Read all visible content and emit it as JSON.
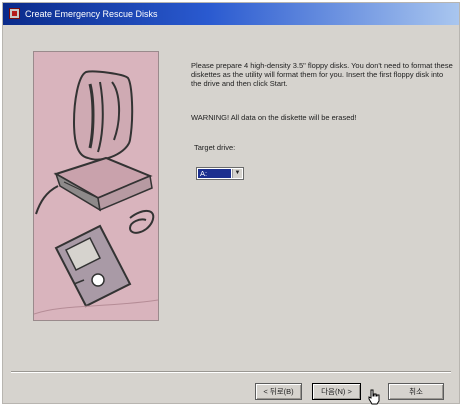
{
  "window": {
    "title": "Create Emergency Rescue Disks"
  },
  "content": {
    "instructions": "Please prepare 4 high-density 3.5\" floppy disks. You don't need to format these diskettes as the utility will format them for you. Insert the first floppy disk into the drive and then click Start.",
    "warning": "WARNING! All data on the diskette will be erased!",
    "target_drive_label": "Target drive:",
    "target_drive_value": "A:"
  },
  "buttons": {
    "back": "< 뒤로(B)",
    "next": "다음(N) >",
    "cancel": "취소"
  },
  "icons": {
    "title_icon": "app-icon",
    "illustration": "computer-floppy-illustration",
    "dropdown": "chevron-down-icon",
    "cursor": "hand-cursor-icon"
  },
  "colors": {
    "title_gradient_start": "#0a2a8a",
    "title_gradient_end": "#a9c6ef",
    "art_background": "#d9b4bd",
    "selection": "#1c2f8f"
  }
}
